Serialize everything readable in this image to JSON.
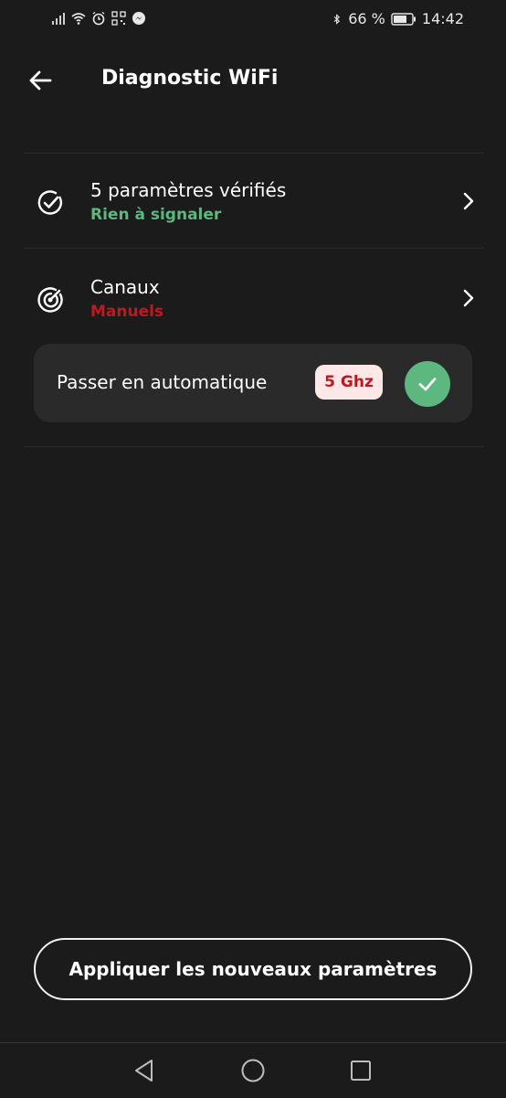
{
  "status_bar": {
    "battery": "66 %",
    "time": "14:42",
    "icons": [
      "signal-icon",
      "wifi-icon",
      "alarm-icon",
      "qr-icon",
      "messenger-icon",
      "bluetooth-icon",
      "battery-icon"
    ]
  },
  "header": {
    "title": "Diagnostic WiFi"
  },
  "rows": [
    {
      "title": "5 paramètres vérifiés",
      "subtitle": "Rien à signaler",
      "subtitle_color": "#5cb87e",
      "icon": "check-circle-icon"
    },
    {
      "title": "Canaux",
      "subtitle": "Manuels",
      "subtitle_color": "#c4161c",
      "icon": "radar-icon"
    }
  ],
  "auto_card": {
    "label": "Passer en automatique",
    "badge": "5 Ghz",
    "badge_color": "#c4161c",
    "confirm_color": "#5cb87e"
  },
  "apply_button": {
    "label": "Appliquer les nouveaux paramètres"
  },
  "nav": {
    "items": [
      "back-nav-icon",
      "home-nav-icon",
      "recents-nav-icon"
    ]
  }
}
